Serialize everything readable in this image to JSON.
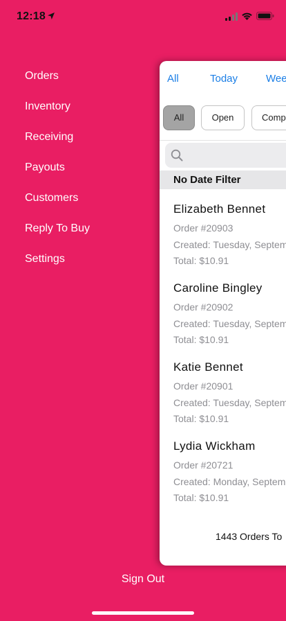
{
  "status_bar": {
    "time": "12:18"
  },
  "menu": {
    "items": [
      {
        "label": "Orders"
      },
      {
        "label": "Inventory"
      },
      {
        "label": "Receiving"
      },
      {
        "label": "Payouts"
      },
      {
        "label": "Customers"
      },
      {
        "label": "Reply To Buy"
      },
      {
        "label": "Settings"
      }
    ],
    "sign_out": "Sign Out"
  },
  "orders_panel": {
    "tabs": [
      {
        "label": "All"
      },
      {
        "label": "Today"
      },
      {
        "label": "Wee"
      }
    ],
    "filters": [
      {
        "label": "All",
        "selected": true
      },
      {
        "label": "Open"
      },
      {
        "label": "Comp"
      }
    ],
    "search": {
      "placeholder": ""
    },
    "section_header": "No Date Filter",
    "orders": [
      {
        "name": "Elizabeth Bennet",
        "number": "Order #20903",
        "created": "Created: Tuesday, Septem",
        "total": "Total: $10.91"
      },
      {
        "name": "Caroline Bingley",
        "number": "Order #20902",
        "created": "Created: Tuesday, Septem",
        "total": "Total: $10.91"
      },
      {
        "name": "Katie Bennet",
        "number": "Order #20901",
        "created": "Created: Tuesday, Septem",
        "total": "Total: $10.91"
      },
      {
        "name": "Lydia Wickham",
        "number": "Order #20721",
        "created": "Created: Monday, Septem",
        "total": "Total: $10.91"
      }
    ],
    "footer": "1443 Orders To"
  },
  "colors": {
    "background": "#E91E63",
    "tab_text": "#1a7ee6",
    "selected_filter": "#a4a4a4",
    "secondary_text": "#8e8e93"
  }
}
